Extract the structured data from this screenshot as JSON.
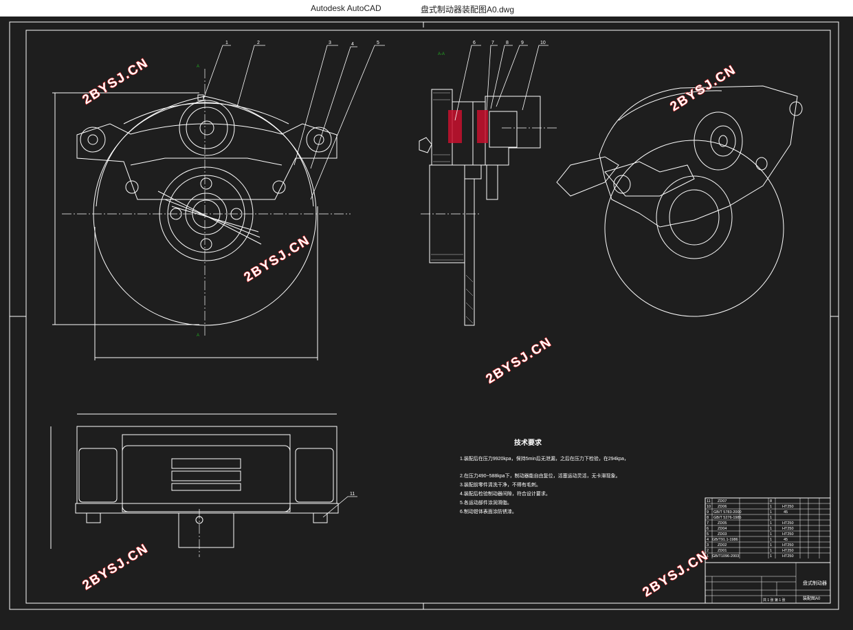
{
  "window": {
    "app_title": "Autodesk AutoCAD",
    "file_title": "盘式制动器装配图A0.dwg"
  },
  "watermarks": [
    "2BYSJ.CN",
    "2BYSJ.CN",
    "2BYSJ.CN",
    "2BYSJ.CN",
    "2BYSJ.CN",
    "2BYSJ.CN"
  ],
  "balloons": [
    "1",
    "2",
    "3",
    "4",
    "5",
    "6",
    "7",
    "8",
    "9",
    "10",
    "11"
  ],
  "tech_requirements": {
    "title": "技术要求",
    "lines": [
      "1.装配后在压力9920kpa，保持5min后无泄漏，之后在压力下检验，在294kpa，",
      "2.在压力490~588kpa下，制动器能自由复位，活塞运动灵活，无卡滞现象。",
      "3.装配前零件清洗干净，不得有毛刺。",
      "4.装配后检验制动器间隙，符合设计要求。",
      "5.各运动部件涂润滑脂。",
      "6.制动钳体表面涂防锈漆。"
    ]
  },
  "bom": {
    "rows": [
      {
        "no": "11",
        "code": "ZD07",
        "qty": "8",
        "material": ""
      },
      {
        "no": "10",
        "code": "ZD06",
        "qty": "1",
        "material": "HT250"
      },
      {
        "no": "9",
        "code": "GB/T 5783-2000",
        "qty": "1",
        "material": "45"
      },
      {
        "no": "8",
        "code": "GB/T 5276-1985",
        "qty": "1",
        "material": ""
      },
      {
        "no": "7",
        "code": "ZD05",
        "qty": "1",
        "material": "HT250"
      },
      {
        "no": "6",
        "code": "ZD04",
        "qty": "1",
        "material": "HT250"
      },
      {
        "no": "5",
        "code": "ZD03",
        "qty": "1",
        "material": "HT250"
      },
      {
        "no": "4",
        "code": "GB/T91.1-1986",
        "qty": "1",
        "material": "45"
      },
      {
        "no": "3",
        "code": "ZD02",
        "qty": "1",
        "material": "HT250"
      },
      {
        "no": "2",
        "code": "ZD01",
        "qty": "1",
        "material": "HT250"
      },
      {
        "no": "1",
        "code": "GB/T1096-2003",
        "qty": "1",
        "material": "HT250"
      }
    ]
  },
  "title_block": {
    "drawing_name": "盘式制动器",
    "drawing_code": "装配图A0",
    "sheet_info": "共 1 张 第 1 张"
  },
  "colors": {
    "background": "#1e1e1e",
    "lines": "#ffffff",
    "section_fill": "#c8102e",
    "watermark_stroke": "#e02020",
    "marker": "#22aa22"
  }
}
